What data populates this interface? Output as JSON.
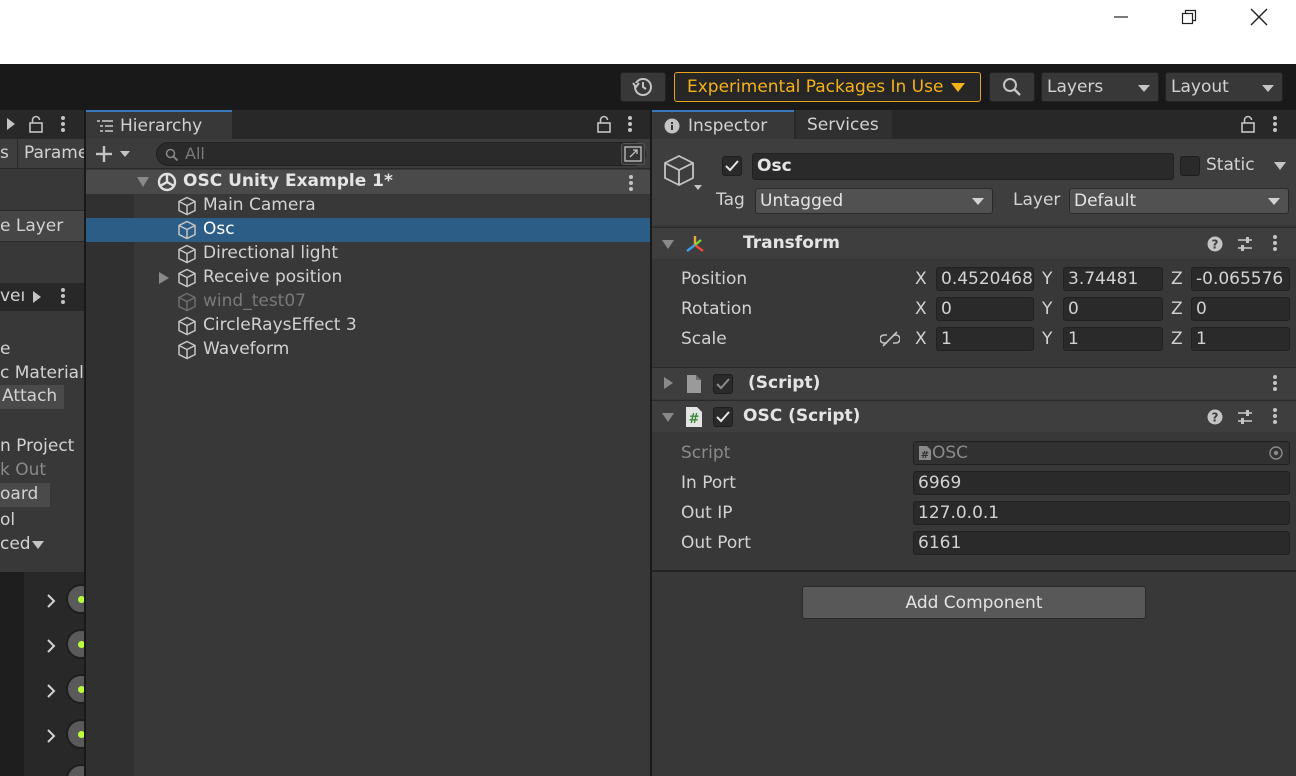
{
  "toolbar": {
    "experimental_label": "Experimental Packages In Use",
    "layers_label": "Layers",
    "layout_label": "Layout"
  },
  "left_panel": {
    "tab_partial": "s",
    "tab_params_partial": "Parame",
    "layer_label": "e Layer",
    "section_label": "veı",
    "items": [
      "e",
      "c Material",
      "Attach",
      "n Project",
      "k Out",
      "oard",
      "ol",
      "ced"
    ]
  },
  "hierarchy": {
    "tab_label": "Hierarchy",
    "search_placeholder": "All",
    "scene_name": "OSC Unity Example 1*",
    "items": [
      {
        "label": "Main Camera",
        "selected": false,
        "disabled": false,
        "expandable": false
      },
      {
        "label": "Osc",
        "selected": true,
        "disabled": false,
        "expandable": false
      },
      {
        "label": "Directional light",
        "selected": false,
        "disabled": false,
        "expandable": false
      },
      {
        "label": "Receive position",
        "selected": false,
        "disabled": false,
        "expandable": true
      },
      {
        "label": "wind_test07",
        "selected": false,
        "disabled": true,
        "expandable": false
      },
      {
        "label": "CircleRaysEffect 3",
        "selected": false,
        "disabled": false,
        "expandable": false
      },
      {
        "label": "Waveform",
        "selected": false,
        "disabled": false,
        "expandable": false
      }
    ]
  },
  "inspector": {
    "tab_label": "Inspector",
    "services_tab_label": "Services",
    "object_name": "Osc",
    "static_label": "Static",
    "tag_label": "Tag",
    "tag_value": "Untagged",
    "layer_label": "Layer",
    "layer_value": "Default",
    "transform": {
      "title": "Transform",
      "position_label": "Position",
      "rotation_label": "Rotation",
      "scale_label": "Scale",
      "position": {
        "x": "0.4520468",
        "y": "3.74481",
        "z": "-0.065576"
      },
      "rotation": {
        "x": "0",
        "y": "0",
        "z": "0"
      },
      "scale": {
        "x": "1",
        "y": "1",
        "z": "1"
      },
      "axis_x": "X",
      "axis_y": "Y",
      "axis_z": "Z"
    },
    "missing_script_title": "(Script)",
    "osc_script": {
      "title": "OSC (Script)",
      "script_label": "Script",
      "script_value": "OSC",
      "in_port_label": "In Port",
      "in_port_value": "6969",
      "out_ip_label": "Out IP",
      "out_ip_value": "127.0.0.1",
      "out_port_label": "Out Port",
      "out_port_value": "6161"
    },
    "add_component_label": "Add Component"
  },
  "colors": {
    "accent_selection": "#2c5d87",
    "warning": "#f4b21a"
  }
}
